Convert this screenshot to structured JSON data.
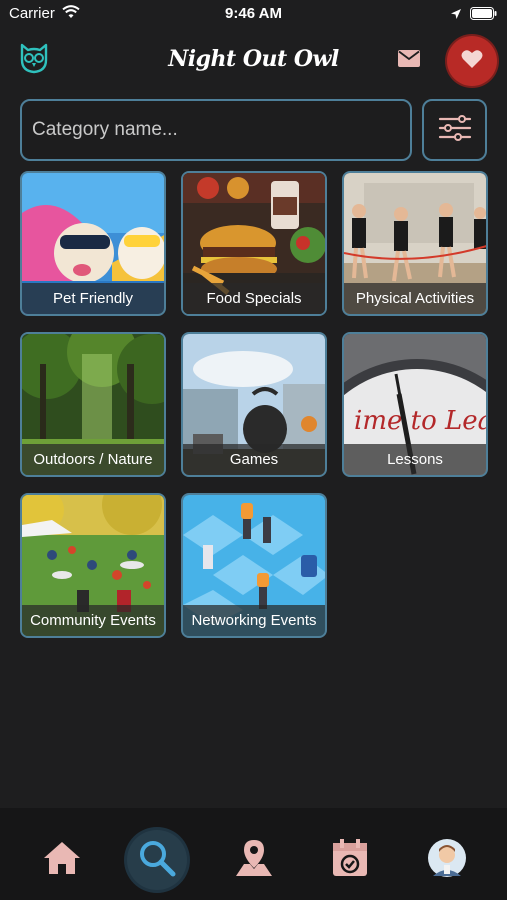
{
  "status_bar": {
    "carrier": "Carrier",
    "time": "9:46 AM"
  },
  "header": {
    "title": "Night Out Owl"
  },
  "search": {
    "placeholder": "Category name..."
  },
  "categories": [
    {
      "label": "Pet Friendly"
    },
    {
      "label": "Food Specials"
    },
    {
      "label": "Physical Activities"
    },
    {
      "label": "Outdoors / Nature"
    },
    {
      "label": "Games"
    },
    {
      "label": "Lessons"
    },
    {
      "label": "Community Events"
    },
    {
      "label": "Networking Events"
    }
  ],
  "tab_bar": {
    "tabs": [
      "home",
      "search",
      "map",
      "calendar",
      "profile"
    ],
    "active": "search"
  },
  "colors": {
    "accent": "#4e7f99",
    "favorite": "#b82a26",
    "icon": "#e9b8b4",
    "background": "#1e1e1f"
  }
}
